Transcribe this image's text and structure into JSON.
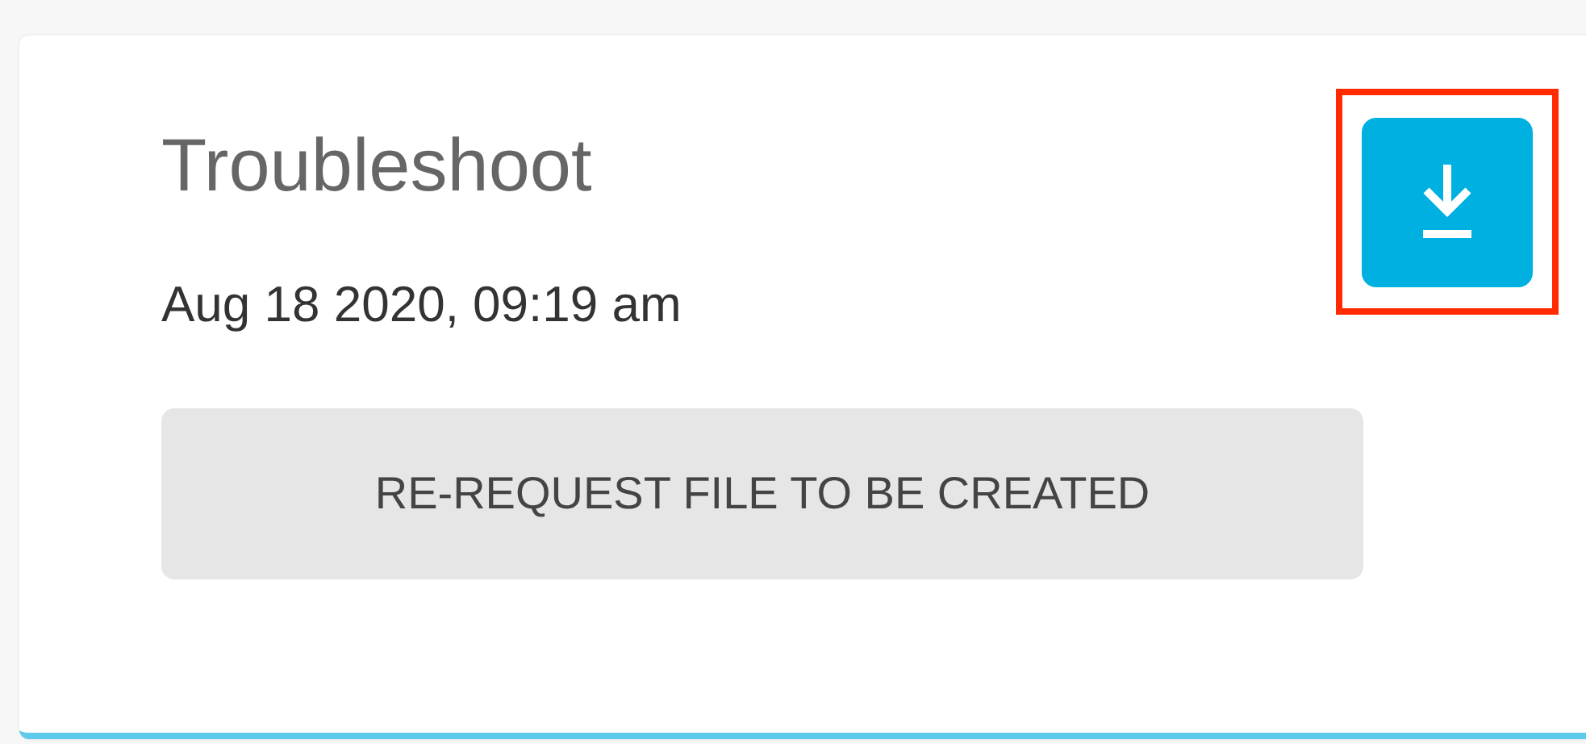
{
  "card": {
    "title": "Troubleshoot",
    "timestamp": "Aug 18 2020, 09:19 am",
    "action_button": "RE-REQUEST FILE TO BE CREATED",
    "download_highlighted": true
  }
}
